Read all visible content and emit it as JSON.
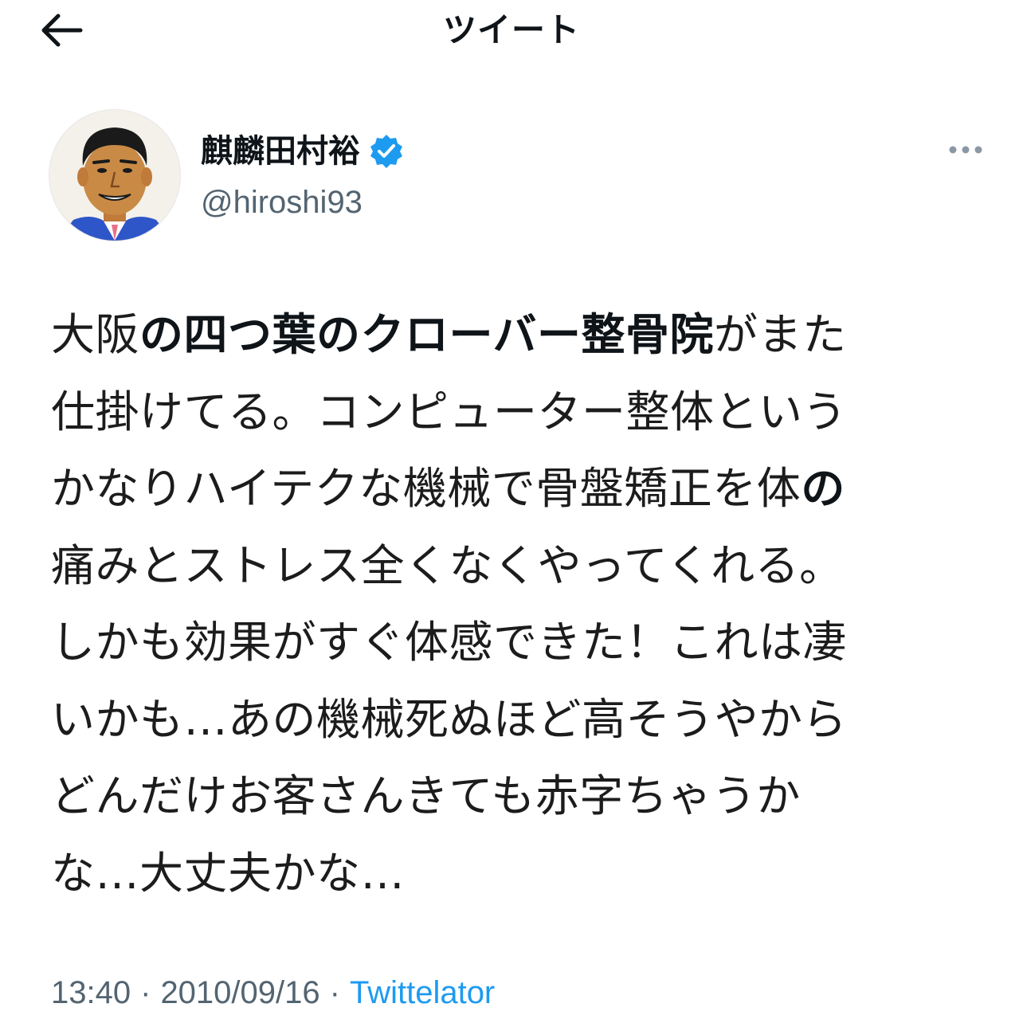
{
  "header": {
    "title": "ツイート",
    "back_icon": "arrow-left-icon"
  },
  "author": {
    "display_name": "麒麟田村裕",
    "handle": "@hiroshi93",
    "verified": true,
    "verified_color": "#1d9bf0",
    "more_icon": "more-horizontal-icon"
  },
  "tweet": {
    "lines": [
      [
        {
          "t": "大阪",
          "b": false
        },
        {
          "t": "の四つ葉のクローバー整骨院",
          "b": true
        },
        {
          "t": "がまた",
          "b": false
        }
      ],
      [
        {
          "t": "仕掛けてる。コンピューター整体という",
          "b": false
        }
      ],
      [
        {
          "t": "かなりハイテクな機械で骨盤矯正を体",
          "b": false
        },
        {
          "t": "の",
          "b": true
        }
      ],
      [
        {
          "t": "痛みとストレス全くなくやってくれる。",
          "b": false
        }
      ],
      [
        {
          "t": "しかも効果がすぐ体感できた！これは凄",
          "b": false
        }
      ],
      [
        {
          "t": "いかも…あの機械死ぬほど高そうやから",
          "b": false
        }
      ],
      [
        {
          "t": "どんだけお客さんきても赤字ちゃうか",
          "b": false
        }
      ],
      [
        {
          "t": "な…大丈夫かな…",
          "b": false
        }
      ]
    ]
  },
  "meta": {
    "time": "13:40",
    "date": "2010/09/16",
    "separator": "·",
    "source": "Twittelator",
    "source_color": "#1d9bf0"
  }
}
